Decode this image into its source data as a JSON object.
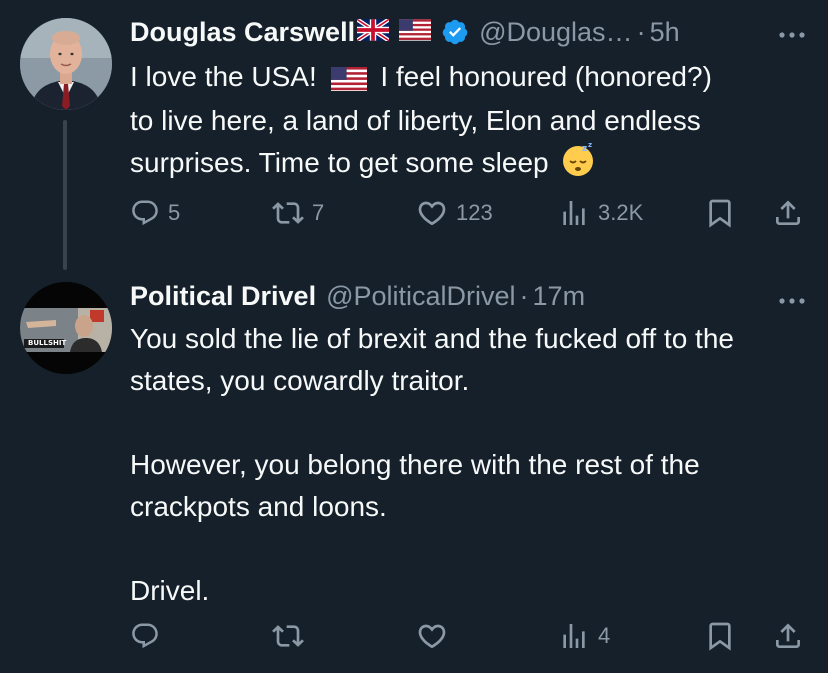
{
  "tweets": [
    {
      "author_name": "Douglas Carswell",
      "handle": "@Douglas…",
      "separator": "·",
      "time": "5h",
      "verified": true,
      "flags": [
        "uk-flag-icon",
        "us-flag-icon"
      ],
      "text_lines": [
        "I love the USA!  ",
        " I feel honoured (honored?)",
        "to live here, a land of liberty, Elon and endless",
        "surprises.  Time to get some sleep "
      ],
      "emoji": "sleeping-face-icon",
      "stats": {
        "replies": "5",
        "reposts": "7",
        "likes": "123",
        "views": "3.2K"
      }
    },
    {
      "author_name": "Political Drivel",
      "handle": "@PoliticalDrivel",
      "separator": "·",
      "time": "17m",
      "avatar_text": "BULLSHIT",
      "paragraphs": [
        "You sold the lie of brexit and the fucked off to the states, you cowardly traitor.",
        "However, you belong there with the rest of the crackpots and loons.",
        "Drivel."
      ],
      "stats": {
        "replies": "",
        "reposts": "",
        "likes": "",
        "views": "4"
      }
    }
  ],
  "colors": {
    "background": "#15202b",
    "text_primary": "#f7f9f9",
    "text_secondary": "#8b98a5",
    "verified_blue": "#1d9bf0",
    "thread_line": "#38444d"
  }
}
